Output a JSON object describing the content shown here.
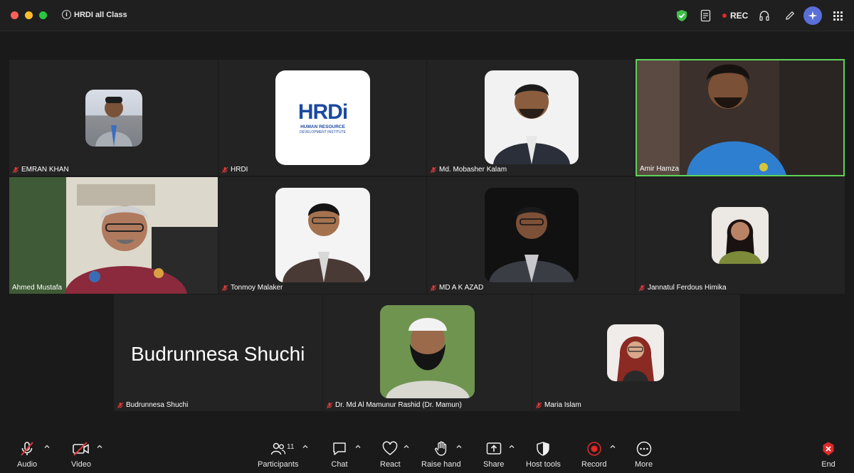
{
  "window": {
    "meeting_title": "HRDI all Class",
    "rec_label": "REC"
  },
  "participants": {
    "emran": "EMRAN KHAN",
    "hrdi": "HRDI",
    "mobasher": "Md. Mobasher Kalam",
    "amir": "Amir Hamza",
    "ahmed": "Ahmed Mustafa",
    "tonmoy": "Tonmoy Malaker",
    "azad": "MD A K AZAD",
    "jannatul": "Jannatul Ferdous Himika",
    "budrunnesa": "Budrunnesa Shuchi",
    "mamun": "Dr. Md Al Mamunur Rashid (Dr. Mamun)",
    "maria": "Maria Islam"
  },
  "big_name": "Budrunnesa Shuchi",
  "hrdi_logo": {
    "wordmark": "HRDi",
    "line1": "HUMAN RESOURCE",
    "line2": "DEVELOPMENT INSTITUTE"
  },
  "toolbar": {
    "audio": "Audio",
    "video": "Video",
    "participants": "Participants",
    "participants_count": "11",
    "chat": "Chat",
    "react": "React",
    "raise_hand": "Raise hand",
    "share": "Share",
    "host_tools": "Host tools",
    "record": "Record",
    "more": "More",
    "end": "End"
  },
  "colors": {
    "speaking_border": "#5fd35a",
    "muted_mic": "#e0393b",
    "record_red": "#e02828",
    "ai_button": "#5a6fd8",
    "hrdi_blue": "#1b4aa0"
  }
}
